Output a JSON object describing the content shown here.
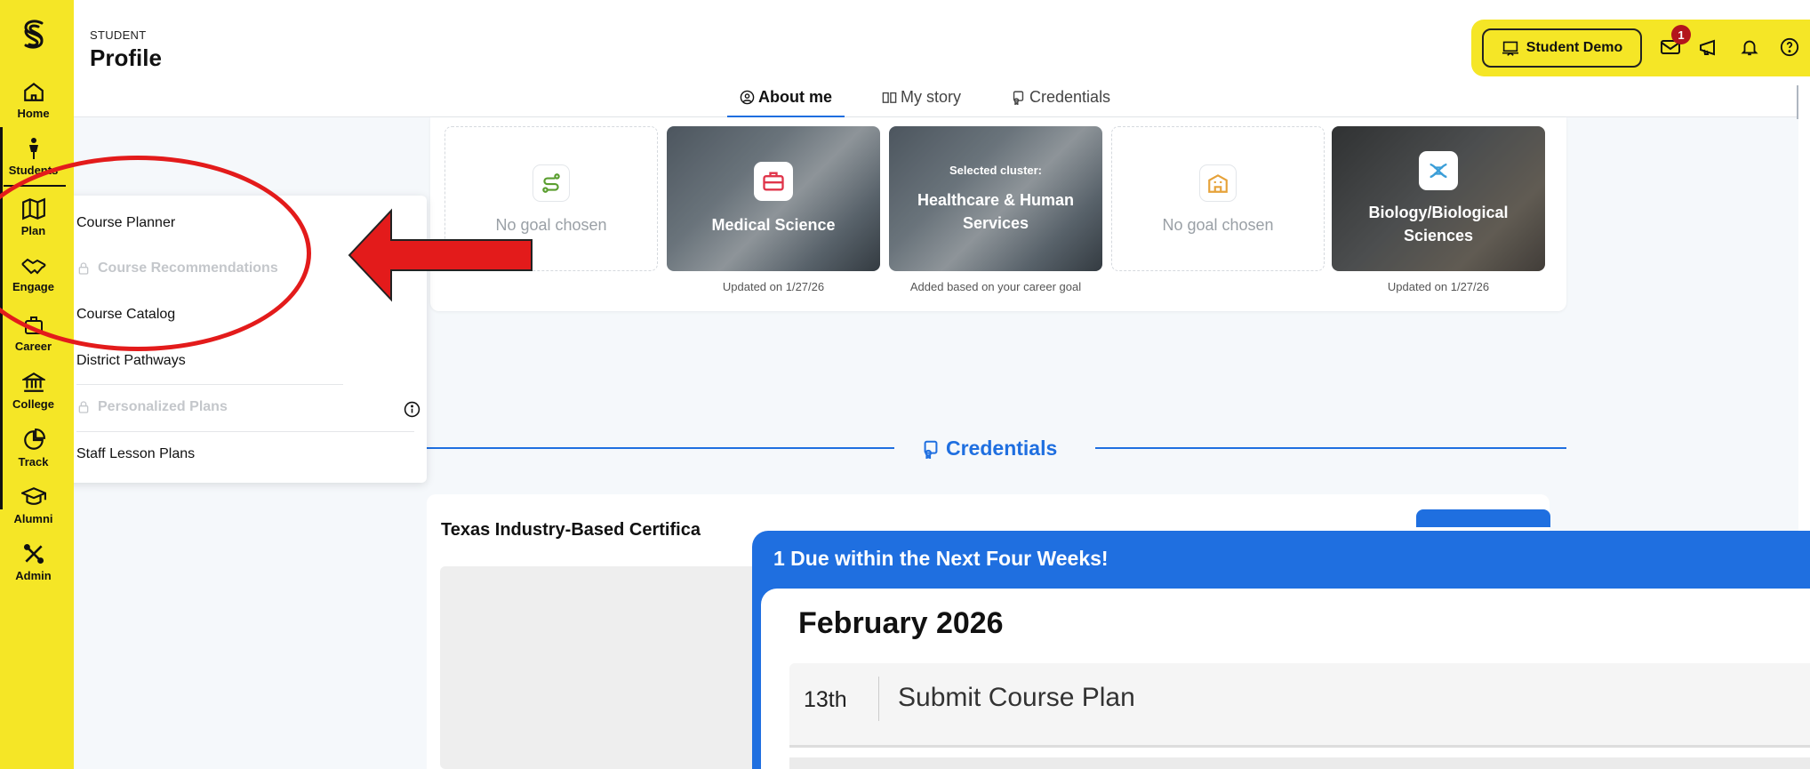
{
  "app": {
    "eyebrow": "STUDENT",
    "page_title": "Profile"
  },
  "rail": {
    "items": [
      {
        "label": "Home",
        "icon": "home-icon"
      },
      {
        "label": "Students",
        "icon": "person-icon"
      },
      {
        "label": "Plan",
        "icon": "map-icon"
      },
      {
        "label": "Engage",
        "icon": "handshake-icon"
      },
      {
        "label": "Career",
        "icon": "briefcase-icon"
      },
      {
        "label": "College",
        "icon": "institution-icon"
      },
      {
        "label": "Track",
        "icon": "pie-chart-icon"
      },
      {
        "label": "Alumni",
        "icon": "graduation-cap-icon"
      },
      {
        "label": "Admin",
        "icon": "tools-icon"
      }
    ]
  },
  "tabs": [
    {
      "label": "About me",
      "icon": "user-circle-icon",
      "active": true
    },
    {
      "label": "My story",
      "icon": "book-icon",
      "active": false
    },
    {
      "label": "Credentials",
      "icon": "certificate-icon",
      "active": false
    }
  ],
  "topbar": {
    "demo_label": "Student Demo",
    "mail_badge": "1",
    "icons": [
      "mail-icon",
      "megaphone-icon",
      "bell-icon",
      "help-icon"
    ]
  },
  "goals": {
    "cards": [
      {
        "kind": "empty",
        "text": "No goal chosen",
        "icon": "route-icon",
        "note": ""
      },
      {
        "kind": "image",
        "title": "Medical Science",
        "icon": "briefcase-icon",
        "note": "Updated on 1/27/26"
      },
      {
        "kind": "image",
        "small": "Selected cluster:",
        "title": "Healthcare & Human Services",
        "icon": "",
        "note": "Added based on your career goal"
      },
      {
        "kind": "empty",
        "text": "No goal chosen",
        "icon": "school-icon",
        "note": ""
      },
      {
        "kind": "image",
        "title": "Biology/Biological Sciences",
        "icon": "dna-icon",
        "note": "Updated on 1/27/26"
      }
    ]
  },
  "menu": {
    "items": [
      {
        "label": "Course Planner",
        "locked": false
      },
      {
        "label": "Course Recommendations",
        "locked": true
      },
      {
        "label": "Course Catalog",
        "locked": false
      },
      {
        "label": "District Pathways",
        "locked": false
      },
      {
        "label": "Personalized Plans",
        "locked": true
      },
      {
        "label": "Staff Lesson Plans",
        "locked": false
      }
    ]
  },
  "credentials": {
    "section_title": "Credentials",
    "card_heading": "Texas Industry-Based Certifica"
  },
  "due_popup": {
    "header": "1 Due within the Next Four Weeks!",
    "month": "February 2026",
    "items": [
      {
        "day": "13th",
        "task": "Submit Course Plan"
      }
    ]
  },
  "colors": {
    "rail": "#f5e626",
    "accent": "#1f6fe0",
    "annotation": "#e31b1b",
    "badge": "#b3151c"
  }
}
